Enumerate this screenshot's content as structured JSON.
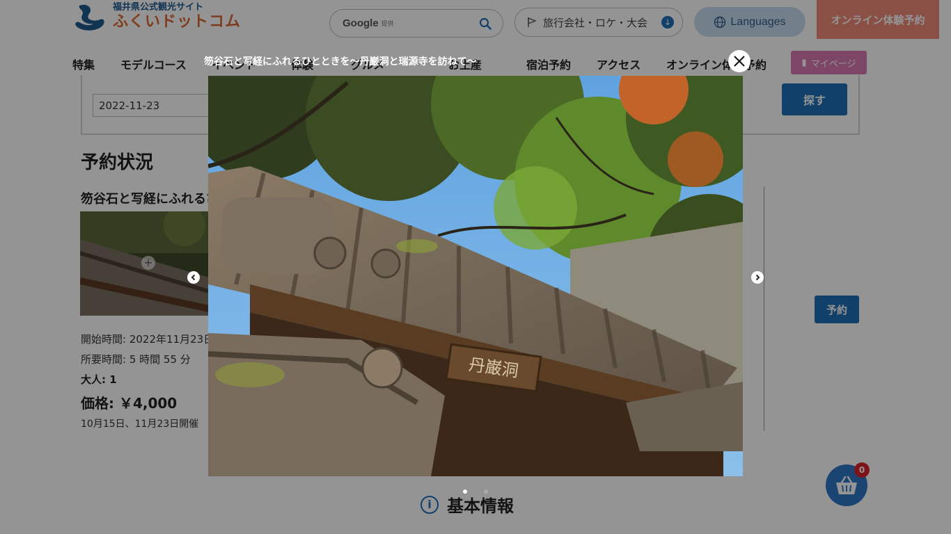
{
  "header": {
    "logo_sub": "福井県公式観光サイト",
    "logo_main": "ふくいドットコム",
    "search": {
      "brand": "Google",
      "provided": "提供",
      "placeholder": ""
    },
    "agency_label": "旅行会社・ロケ・大会",
    "languages_label": "Languages",
    "online_booking_label": "オンライン体験予約",
    "mypage_label": "マイページ"
  },
  "nav": {
    "items": [
      "特集",
      "モデルコース",
      "イベント",
      "体験",
      "グルメ",
      "お土産",
      "宿泊予約",
      "アクセス",
      "オンライン体験予約"
    ]
  },
  "form": {
    "date_value": "2022-11-23",
    "find_label": "探す"
  },
  "main": {
    "status_heading": "予約状況",
    "card": {
      "title": "笏谷石と写経にふれるひととき",
      "start_time": "開始時間: 2022年11月23日",
      "duration": "所要時間: 5 時間 55 分",
      "adults": "大人: 1",
      "price": "価格: ￥4,000",
      "note": "10月15日、11月23日開催"
    },
    "reserve_label": "予約",
    "basic_info_heading": "基本情報",
    "info_icon": "i"
  },
  "cart": {
    "count": "0",
    "icon": "basket-icon"
  },
  "lightbox": {
    "caption": "笏谷石と写経にふれるひとときを～丹巌洞と瑞源寺を訪ねて～",
    "image_alt": "丹巌洞 gate with moss-covered tiled roof under autumn trees",
    "gate_plaque": "丹巌洞",
    "slide_count": 2,
    "active_slide": 1
  },
  "colors": {
    "accent_blue": "#1e6fb8",
    "online_btn": "#f08a77",
    "mypage_btn": "#d878b0",
    "lang_btn": "#c7dcef",
    "badge_red": "#d8242b"
  }
}
